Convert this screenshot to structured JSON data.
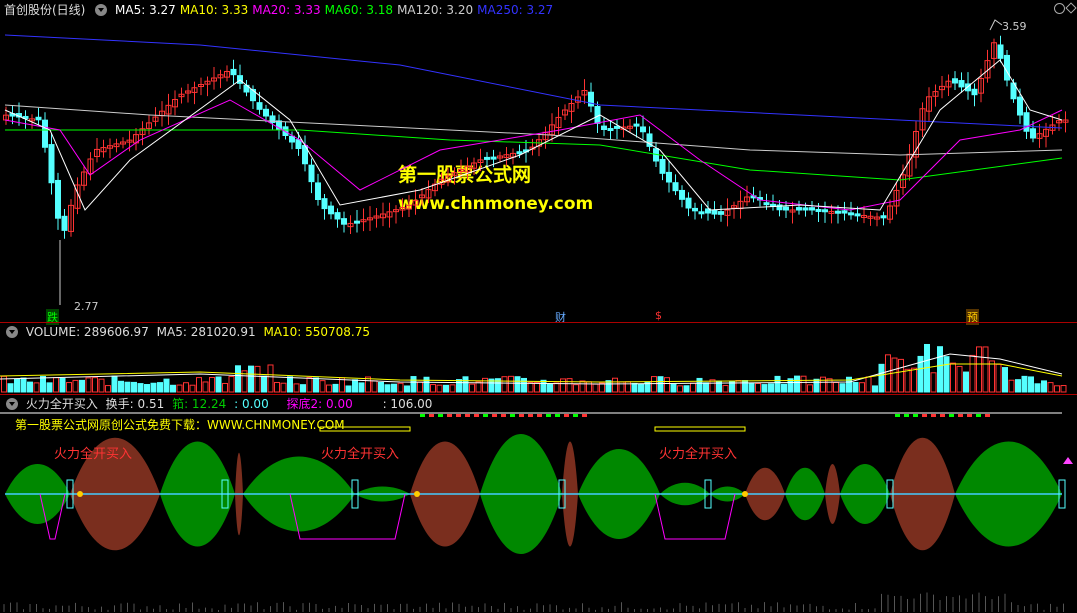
{
  "price_pane": {
    "title": "首创股份(日线)",
    "ma": [
      {
        "label": "MA5: 3.27",
        "color": "#ffffff"
      },
      {
        "label": "MA10: 3.33",
        "color": "#ffff00"
      },
      {
        "label": "MA20: 3.33",
        "color": "#ff00ff"
      },
      {
        "label": "MA60: 3.18",
        "color": "#00ff00"
      },
      {
        "label": "MA120: 3.20",
        "color": "#cccccc"
      },
      {
        "label": "MA250: 3.27",
        "color": "#3333ff"
      }
    ],
    "high_label": "3.59",
    "low_label": "2.77",
    "markers": [
      {
        "text": "跌",
        "color": "#00ff00"
      },
      {
        "text": "财",
        "color": "#66aaff"
      },
      {
        "text": "$",
        "color": "#ff3333"
      },
      {
        "text": "预",
        "color": "#ffcc00"
      }
    ],
    "watermark_cn": "第一股票公式网",
    "watermark_url": "www.chnmoney.com"
  },
  "volume_pane": {
    "label": "VOLUME: 289606.97",
    "ma5": "MA5: 281020.91",
    "ma10": "MA10: 550708.75"
  },
  "indicator_pane": {
    "title": "火力全开买入",
    "huanshou": "换手: 0.51",
    "qian": "筘: 12.24",
    "val3": ": 0.00",
    "tandi": "探底2: 0.00",
    "val5": ": 106.00",
    "watermark": "第一股票公式网原创公式免费下载：WWW.CHNMONEY.COM",
    "buy_labels": [
      "火力全开买入",
      "火力全开买入",
      "火力全开买入"
    ]
  },
  "colors": {
    "up": "#ff3333",
    "down": "#55ffff",
    "green_fill": "#008800",
    "brown_fill": "#7a2e1e",
    "accent": "#ffff00"
  }
}
